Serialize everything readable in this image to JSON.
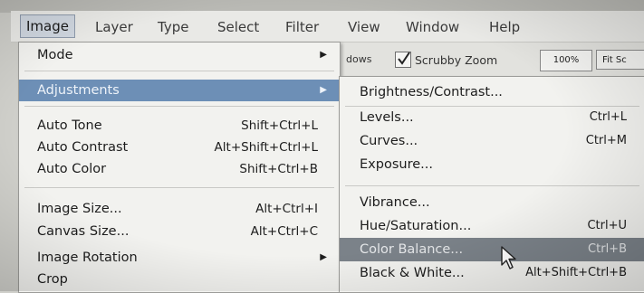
{
  "menubar": {
    "items": [
      "Image",
      "Layer",
      "Type",
      "Select",
      "Filter",
      "View",
      "Window",
      "Help"
    ],
    "active": "Image"
  },
  "options_bar": {
    "windows_fragment": "dows",
    "scrubby_zoom_label": "Scrubby Zoom",
    "scrubby_zoom_checked": true,
    "zoom_100_label": "100%",
    "fit_screen_label": "Fit Sc"
  },
  "image_menu": {
    "mode": "Mode",
    "adjustments": "Adjustments",
    "auto_tone": {
      "label": "Auto Tone",
      "shortcut": "Shift+Ctrl+L"
    },
    "auto_contrast": {
      "label": "Auto Contrast",
      "shortcut": "Alt+Shift+Ctrl+L"
    },
    "auto_color": {
      "label": "Auto Color",
      "shortcut": "Shift+Ctrl+B"
    },
    "image_size": {
      "label": "Image Size...",
      "shortcut": "Alt+Ctrl+I"
    },
    "canvas_size": {
      "label": "Canvas Size...",
      "shortcut": "Alt+Ctrl+C"
    },
    "image_rotation": "Image Rotation",
    "crop": "Crop"
  },
  "adjustments_menu": {
    "brightness_contrast": {
      "label": "Brightness/Contrast..."
    },
    "levels": {
      "label": "Levels...",
      "shortcut": "Ctrl+L"
    },
    "curves": {
      "label": "Curves...",
      "shortcut": "Ctrl+M"
    },
    "exposure": {
      "label": "Exposure..."
    },
    "vibrance": {
      "label": "Vibrance..."
    },
    "hue_saturation": {
      "label": "Hue/Saturation...",
      "shortcut": "Ctrl+U"
    },
    "color_balance": {
      "label": "Color Balance...",
      "shortcut": "Ctrl+B"
    },
    "black_white": {
      "label": "Black & White...",
      "shortcut": "Alt+Shift+Ctrl+B"
    }
  },
  "colors": {
    "menu_bg": "#f2f2ef",
    "highlight_adjustments": "#6d8fb6",
    "highlight_color_balance": "#7b8289"
  },
  "icons": [
    "checkmark-icon",
    "submenu-arrow-icon",
    "mouse-pointer-icon"
  ]
}
